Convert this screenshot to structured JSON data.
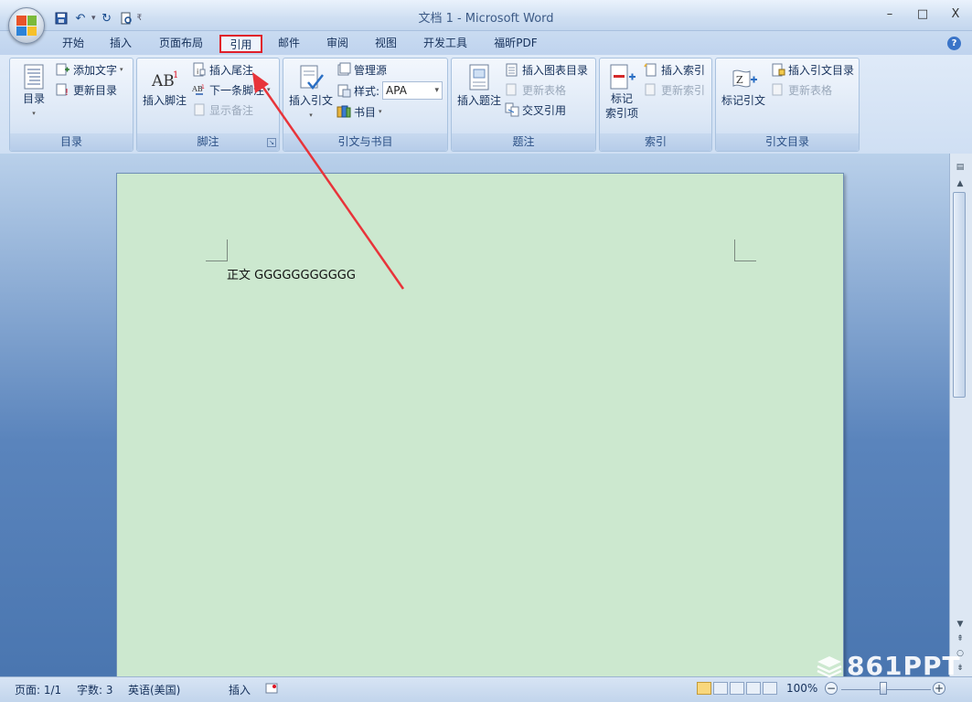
{
  "window": {
    "title": "文档 1 - Microsoft Word",
    "min_glyph": "–",
    "max_glyph": "□",
    "close_glyph": "X"
  },
  "qat": {
    "customize_glyph": "₹"
  },
  "tabs": [
    {
      "label": "开始"
    },
    {
      "label": "插入"
    },
    {
      "label": "页面布局"
    },
    {
      "label": "引用",
      "active": true,
      "highlight": "#e0202a"
    },
    {
      "label": "邮件"
    },
    {
      "label": "审阅"
    },
    {
      "label": "视图"
    },
    {
      "label": "开发工具"
    },
    {
      "label": "福昕PDF"
    }
  ],
  "help_glyph": "?",
  "ribbon": {
    "toc": {
      "label": "目录",
      "big_button": "目录",
      "add_text": "添加文字",
      "update_toc": "更新目录"
    },
    "footnotes": {
      "label": "脚注",
      "insert_footnote": "插入脚注",
      "insert_endnote": "插入尾注",
      "next_footnote": "下一条脚注",
      "show_notes": "显示备注",
      "launcher": "↘"
    },
    "citations": {
      "label": "引文与书目",
      "insert_citation": "插入引文",
      "manage_sources": "管理源",
      "style_label": "样式:",
      "style_value": "APA",
      "bibliography": "书目"
    },
    "captions": {
      "label": "题注",
      "insert_caption": "插入题注",
      "insert_table_of_figures": "插入图表目录",
      "update_table": "更新表格",
      "cross_reference": "交叉引用"
    },
    "index": {
      "label": "索引",
      "mark_entry_line1": "标记",
      "mark_entry_line2": "索引项",
      "insert_index": "插入索引",
      "update_index": "更新索引"
    },
    "toa": {
      "label": "引文目录",
      "mark_citation": "标记引文",
      "insert_toa": "插入引文目录",
      "update_table": "更新表格"
    }
  },
  "document": {
    "body_text": "正文 GGGGGGGGGGG",
    "page_color": "#cce8cf"
  },
  "status": {
    "page": "页面: 1/1",
    "words": "字数: 3",
    "language": "英语(美国)",
    "mode": "插入",
    "zoom": "100%",
    "zoom_minus": "−",
    "zoom_plus": "+"
  },
  "watermark": "861PPT",
  "annotation": {
    "color": "#e8343a",
    "target": "插入尾注"
  },
  "colors": {
    "accent": "#e0202a",
    "ribbon_text": "#15305a",
    "workspace": "#5a84bc"
  }
}
